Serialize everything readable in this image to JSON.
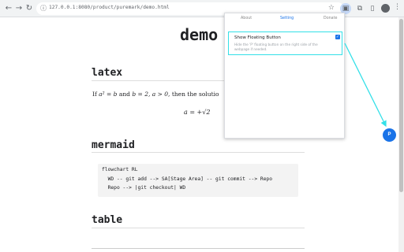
{
  "browser": {
    "url": "127.0.0.1:8080/product/puremark/demo.html",
    "back_icon": "back-arrow",
    "forward_icon": "forward-arrow",
    "reload_icon": "reload"
  },
  "page": {
    "title": "demo",
    "sections": {
      "latex": {
        "heading": "latex",
        "text_prefix": "If ",
        "math1": "a² = b",
        "text_and": " and ",
        "math2": "b = 2, a > 0",
        "text_suffix": ", then the solutio",
        "equation": "a = +√2"
      },
      "mermaid": {
        "heading": "mermaid",
        "code_lines": [
          "flowchart RL",
          "  WD -- git add --> SA[Stage Area] -- git commit --> Repo",
          "  Repo --> |git checkout| WD"
        ]
      },
      "table": {
        "heading": "table"
      }
    }
  },
  "popup": {
    "tabs": [
      "About",
      "Setting",
      "Donate"
    ],
    "active_tab": "Setting",
    "setting": {
      "label": "Show Floating Button",
      "description": "Hide the 'P' floating button on the right side of the webpage if needed.",
      "checked": true
    }
  },
  "floating_button": {
    "label": "P"
  },
  "colors": {
    "accent": "#1a73e8",
    "highlight": "#33e0e8"
  }
}
